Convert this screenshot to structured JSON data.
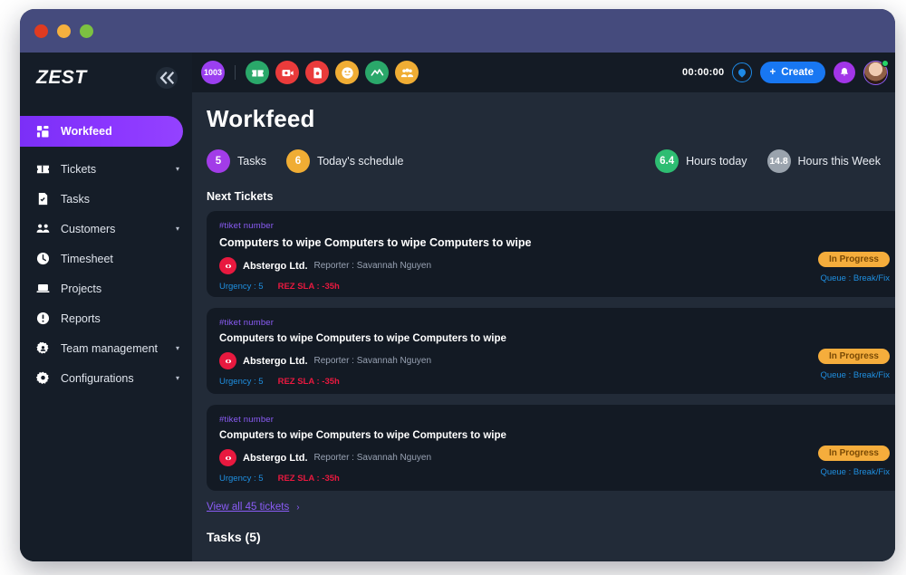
{
  "window": {
    "traffic_lights": [
      "close",
      "minimize",
      "maximize"
    ],
    "chrome_color": "#454b7d"
  },
  "sidebar": {
    "brand": "ZEST",
    "collapse_icon": "chevron-double-left-icon",
    "items": [
      {
        "label": "Workfeed",
        "icon": "grid-dashboard-icon",
        "active": true,
        "caret": ""
      },
      {
        "label": "Tickets",
        "icon": "ticket-icon",
        "active": false,
        "caret": "▾"
      },
      {
        "label": "Tasks",
        "icon": "task-document-icon",
        "active": false,
        "caret": ""
      },
      {
        "label": "Customers",
        "icon": "people-group-icon",
        "active": false,
        "caret": "▾"
      },
      {
        "label": "Timesheet",
        "icon": "clock-icon",
        "active": false,
        "caret": ""
      },
      {
        "label": "Projects",
        "icon": "laptop-icon",
        "active": false,
        "caret": ""
      },
      {
        "label": "Reports",
        "icon": "alert-circle-icon",
        "active": false,
        "caret": ""
      },
      {
        "label": "Team management",
        "icon": "gear-user-icon",
        "active": false,
        "caret": "▾"
      },
      {
        "label": "Configurations",
        "icon": "gear-icon",
        "active": false,
        "caret": "▾"
      }
    ],
    "active_color": "#8b36ff"
  },
  "toolbar": {
    "counter_badge": "1003",
    "chips": [
      {
        "name": "ticket-chip-icon",
        "color": "#2aa86a"
      },
      {
        "name": "video-ticket-chip-icon",
        "color": "#ea3b3b"
      },
      {
        "name": "document-chip-icon",
        "color": "#ea3b3b"
      },
      {
        "name": "smiley-chip-icon",
        "color": "#f0ad34"
      },
      {
        "name": "activity-chart-chip-icon",
        "color": "#2aa86a"
      },
      {
        "name": "team-chip-icon",
        "color": "#f0ad34"
      }
    ],
    "timer": "00:00:00",
    "timer_icon": "water-drop-icon",
    "create_label": "Create",
    "create_plus": "+",
    "create_color": "#1877f2",
    "bell_icon": "bell-icon",
    "bell_color": "#a235e8",
    "avatar_name": "user-avatar",
    "online_status": "online"
  },
  "main": {
    "page_title": "Workfeed",
    "stats_left": [
      {
        "value": "5",
        "label": "Tasks",
        "color": "#a23ce8"
      },
      {
        "value": "6",
        "label": "Today's schedule",
        "color": "#f0ad34"
      }
    ],
    "stats_right": [
      {
        "value": "6.4",
        "label": "Hours today",
        "color": "#2ebd72"
      },
      {
        "value": "14.8",
        "label": "Hours this Week",
        "color": "#9aa3ad"
      }
    ],
    "section_title": "Next Tickets",
    "tickets": [
      {
        "number": "#tiket number",
        "title": "Computers to wipe Computers to wipe Computers to wipe",
        "company": "Abstergo Ltd.",
        "reporter": "Reporter : Savannah Nguyen",
        "urgency": "Urgency : 5",
        "sla": "REZ SLA : -35h",
        "status": "In Progress",
        "queue": "Queue : Break/Fix"
      },
      {
        "number": "#tiket number",
        "title": "Computers to wipe Computers to wipe Computers to wipe",
        "company": "Abstergo Ltd.",
        "reporter": "Reporter : Savannah Nguyen",
        "urgency": "Urgency : 5",
        "sla": "REZ SLA : -35h",
        "status": "In Progress",
        "queue": "Queue : Break/Fix"
      },
      {
        "number": "#tiket number",
        "title": "Computers to wipe Computers to wipe Computers to wipe",
        "company": "Abstergo Ltd.",
        "reporter": "Reporter : Savannah Nguyen",
        "urgency": "Urgency : 5",
        "sla": "REZ SLA : -35h",
        "status": "In Progress",
        "queue": "Queue : Break/Fix"
      }
    ],
    "view_all": "View all 45 tickets",
    "view_all_chevron": "›",
    "tasks_heading": "Tasks (5)"
  }
}
